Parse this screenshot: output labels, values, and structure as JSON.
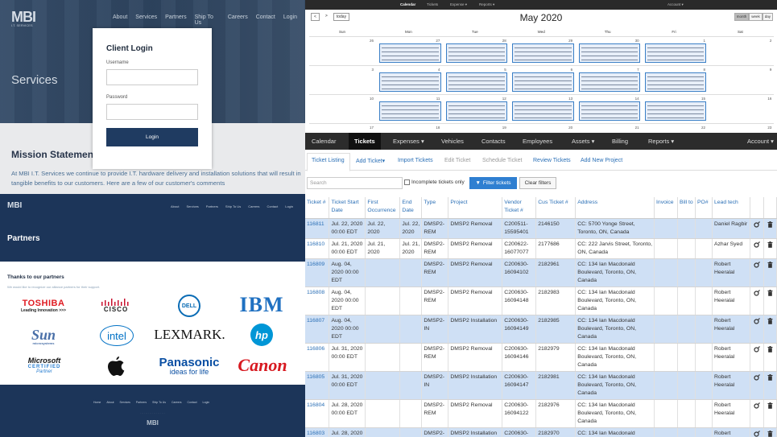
{
  "login_site": {
    "logo": "MBI",
    "logo_sub": "I.T. SERVICES",
    "nav": [
      "About",
      "Services",
      "Partners",
      "Ship To Us",
      "Careers",
      "Contact",
      "Login"
    ],
    "hero_title": "Services",
    "mission_title": "Mission Statement",
    "mission_text": "At MBI I.T. Services we continue to provide I.T. hardware delivery and installation solutions that will result in tangible benefits to our customers. Here are a few of our customer's comments",
    "card": {
      "title": "Client Login",
      "username_label": "Username",
      "password_label": "Password",
      "login_button": "Login"
    }
  },
  "partners_site": {
    "logo": "MBI",
    "nav": [
      "About",
      "Services",
      "Partners",
      "Ship To Us",
      "Careers",
      "Contact",
      "Login"
    ],
    "title": "Partners",
    "thanks": "Thanks to our partners",
    "sub": "We would like to recognize our alliance partners for their support.",
    "logos": {
      "toshiba": "TOSHIBA",
      "toshiba_tag": "Leading Innovation >>>",
      "cisco": "CISCO",
      "dell": "DELL",
      "ibm": "IBM",
      "sun": "Sun",
      "sun_sub": "microsystems",
      "intel": "intel",
      "lexmark": "LEXMARK.",
      "hp": "hp",
      "microsoft": "Microsoft",
      "ms_cert": "CERTIFIED",
      "ms_partner": "Partner",
      "panasonic": "Panasonic",
      "panasonic_tag": "ideas for life",
      "canon": "Canon"
    },
    "footer_nav": [
      "Home",
      "About",
      "Services",
      "Partners",
      "Ship To Us",
      "Careers",
      "Contact",
      "Login"
    ],
    "footer_logo": "MBI"
  },
  "calendar": {
    "topnav": [
      "Calendar",
      "Tickets",
      "Expense ▾",
      "Reports ▾",
      "Account ▾"
    ],
    "controls": {
      "prev": "<",
      "next": ">",
      "today": "today"
    },
    "month": "May 2020",
    "views": [
      "month",
      "week",
      "day"
    ],
    "days": [
      "Sun",
      "Mon",
      "Tue",
      "Wed",
      "Thu",
      "Fri",
      "Sat"
    ],
    "weeks": [
      [
        "26",
        "27",
        "28",
        "29",
        "30",
        "1",
        "2"
      ],
      [
        "3",
        "4",
        "5",
        "6",
        "7",
        "8",
        "9"
      ],
      [
        "10",
        "11",
        "12",
        "13",
        "14",
        "15",
        "16"
      ],
      [
        "17",
        "18",
        "19",
        "20",
        "21",
        "22",
        "23"
      ]
    ]
  },
  "tickets": {
    "nav": [
      "Calendar",
      "Tickets",
      "Expenses ▾",
      "Vehicles",
      "Contacts",
      "Employees",
      "Assets ▾",
      "Billing",
      "Reports ▾",
      "Account ▾"
    ],
    "subnav": [
      "Ticket Listing",
      "Add Ticket▾",
      "Import Tickets",
      "Edit Ticket",
      "Schedule Ticket",
      "Review Tickets",
      "Add New Project"
    ],
    "search_placeholder": "Search",
    "incomplete_label": "Incomplete tickets only",
    "filter_button": "Filter tickets",
    "clear_button": "Clear filters",
    "columns": [
      "Ticket #",
      "Ticket Start Date",
      "First Occurrence",
      "End Date",
      "Type",
      "Project",
      "Vendor Ticket #",
      "Cus Ticket #",
      "Address",
      "Invoice",
      "Bill to",
      "PO#",
      "Lead tech",
      "",
      ""
    ],
    "rows": [
      {
        "id": "116811",
        "start": "Jul. 22, 2020 00:00 EDT",
        "first": "Jul. 22, 2020",
        "end": "Jul. 22, 2020",
        "type": "DMSP2-REM",
        "project": "DMSP2 Removal",
        "vendor": "C200511-15595401",
        "cus": "2146150",
        "address": "CC: 5700 Yonge Street, Toronto, ON, Canada",
        "lead": "Daniel Ragbir"
      },
      {
        "id": "116810",
        "start": "Jul. 21, 2020 00:00 EDT",
        "first": "Jul. 21, 2020",
        "end": "Jul. 21, 2020",
        "type": "DMSP2-REM",
        "project": "DMSP2 Removal",
        "vendor": "C200622-16077077",
        "cus": "2177686",
        "address": "CC: 222 Jarvis Street, Toronto, ON, Canada",
        "lead": "Azhar Syed"
      },
      {
        "id": "116809",
        "start": "Aug. 04, 2020 00:00 EDT",
        "first": "",
        "end": "",
        "type": "DMSP2-REM",
        "project": "DMSP2 Removal",
        "vendor": "C200630-16094102",
        "cus": "2182961",
        "address": "CC: 134 Ian Macdonald Boulevard, Toronto, ON, Canada",
        "lead": "Robert Heeralal"
      },
      {
        "id": "116808",
        "start": "Aug. 04, 2020 00:00 EDT",
        "first": "",
        "end": "",
        "type": "DMSP2-REM",
        "project": "DMSP2 Removal",
        "vendor": "C200630-16094148",
        "cus": "2182983",
        "address": "CC: 134 Ian Macdonald Boulevard, Toronto, ON, Canada",
        "lead": "Robert Heeralal"
      },
      {
        "id": "116807",
        "start": "Aug. 04, 2020 00:00 EDT",
        "first": "",
        "end": "",
        "type": "DMSP2-IN",
        "project": "DMSP2 Installation",
        "vendor": "C200630-16094149",
        "cus": "2182985",
        "address": "CC: 134 Ian Macdonald Boulevard, Toronto, ON, Canada",
        "lead": "Robert Heeralal"
      },
      {
        "id": "116806",
        "start": "Jul. 31, 2020 00:00 EDT",
        "first": "",
        "end": "",
        "type": "DMSP2-REM",
        "project": "DMSP2 Removal",
        "vendor": "C200630-16094146",
        "cus": "2182979",
        "address": "CC: 134 Ian Macdonald Boulevard, Toronto, ON, Canada",
        "lead": "Robert Heeralal"
      },
      {
        "id": "116805",
        "start": "Jul. 31, 2020 00:00 EDT",
        "first": "",
        "end": "",
        "type": "DMSP2-IN",
        "project": "DMSP2 Installation",
        "vendor": "C200630-16094147",
        "cus": "2182981",
        "address": "CC: 134 Ian Macdonald Boulevard, Toronto, ON, Canada",
        "lead": "Robert Heeralal"
      },
      {
        "id": "116804",
        "start": "Jul. 28, 2020 00:00 EDT",
        "first": "",
        "end": "",
        "type": "DMSP2-REM",
        "project": "DMSP2 Removal",
        "vendor": "C200630-16094122",
        "cus": "2182976",
        "address": "CC: 134 Ian Macdonald Boulevard, Toronto, ON, Canada",
        "lead": "Robert Heeralal"
      },
      {
        "id": "116803",
        "start": "Jul. 28, 2020",
        "first": "",
        "end": "",
        "type": "DMSP2-",
        "project": "DMSP2 Installation",
        "vendor": "C200630-",
        "cus": "2182970",
        "address": "CC: 134 Ian Macdonald",
        "lead": "Robert"
      }
    ],
    "icons": [
      "edit-icon",
      "delete-icon"
    ]
  },
  "colors": {
    "brand_navy": "#1c3559",
    "login_button": "#1f3b61",
    "row_highlight": "#cfe0f5",
    "link_blue": "#2a6fb6",
    "filter_button": "#2f7fd1"
  }
}
